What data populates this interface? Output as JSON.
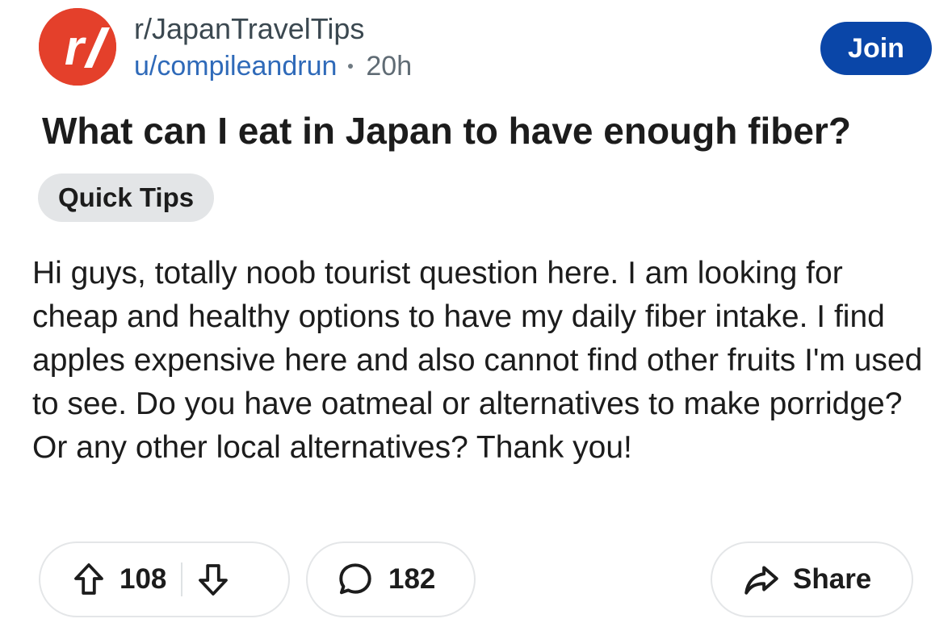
{
  "post": {
    "subreddit": "r/JapanTravelTips",
    "username": "u/compileandrun",
    "time": "20h",
    "join_label": "Join",
    "title": "What can I eat in Japan to have enough fiber?",
    "flair": "Quick Tips",
    "body": "Hi guys, totally noob tourist question here. I am looking for cheap and healthy options to have my daily fiber intake. I find apples expensive here and also cannot find other fruits I'm used to see. Do you have oatmeal or alternatives to make porridge? Or any other local alternatives? Thank you!"
  },
  "actions": {
    "upvotes": "108",
    "comments": "182",
    "share_label": "Share"
  },
  "icons": {
    "avatar": "subreddit-avatar-icon",
    "upvote": "upvote-arrow-icon",
    "downvote": "downvote-arrow-icon",
    "comment": "comment-bubble-icon",
    "share": "share-arrow-icon"
  },
  "colors": {
    "avatar_bg": "#e4402b",
    "join_bg": "#0a46a8",
    "username": "#2f6ab9",
    "flair_bg": "#e3e5e7"
  }
}
